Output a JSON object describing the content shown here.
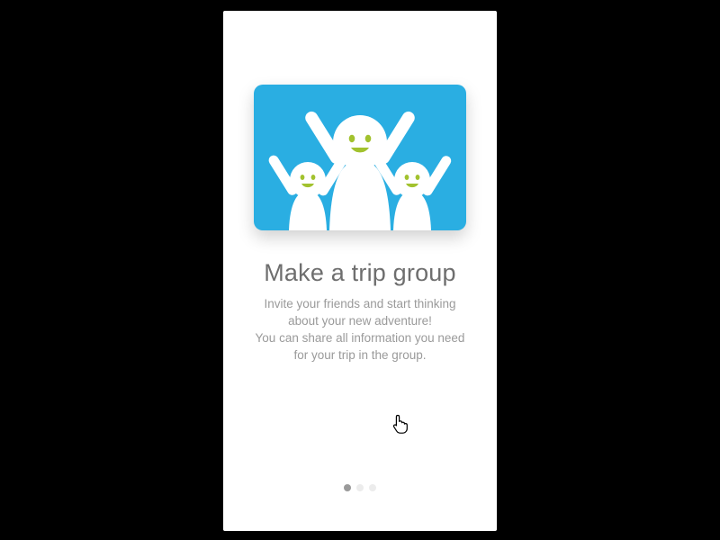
{
  "colors": {
    "page_bg": "#000000",
    "card_bg": "#FFFFFF",
    "illustration_bg": "#2AAEE2",
    "accent_green": "#A2C22E",
    "heading": "#6E6E6E",
    "body": "#9A9A9A",
    "dot_active": "#9A9A9A",
    "dot_inactive": "#ECECEC"
  },
  "illustration": "group-cheering-icon",
  "heading": "Make a trip group",
  "body_line1": "Invite your friends and start thinking",
  "body_line2": "about your new adventure!",
  "body_line3": "You can share all information you need",
  "body_line4": "for your trip in the group.",
  "pagination": {
    "count": 3,
    "active_index": 0
  },
  "cursor": "hand-pointer-icon"
}
